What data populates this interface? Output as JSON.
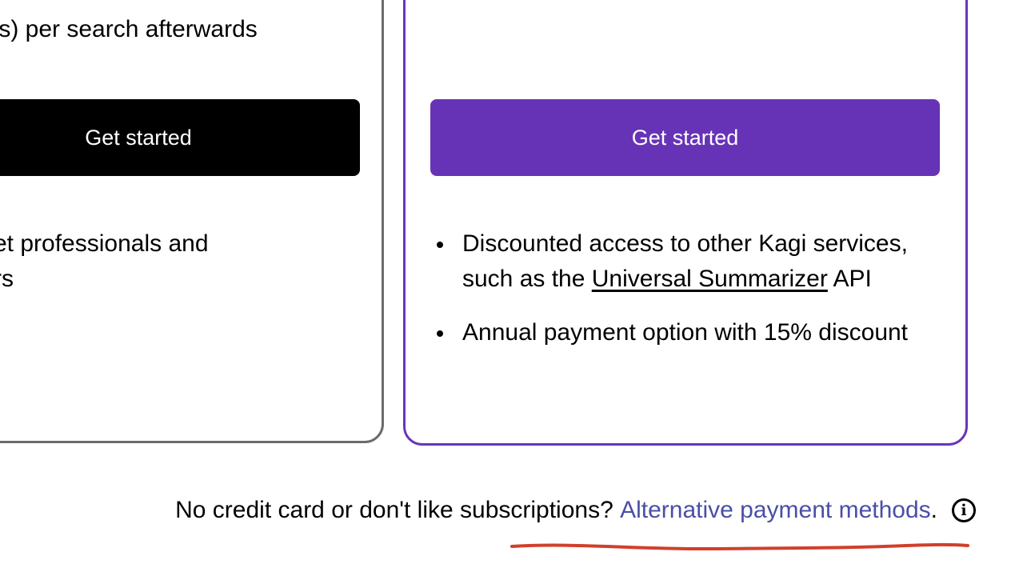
{
  "left_plan": {
    "line_pricing": "ts) per search afterwards",
    "button_label": "Get started",
    "feature_line1": "et professionals and",
    "feature_line2": "rs"
  },
  "right_plan": {
    "button_label": "Get started",
    "features": {
      "item1_text_before": "Discounted access to other Kagi services, such as the ",
      "item1_link": "Universal Summarizer",
      "item1_text_after": " API",
      "item2": "Annual payment option with 15% discount"
    }
  },
  "footer": {
    "prompt": "No credit card or don't like subscriptions? ",
    "link_label": "Alternative payment methods",
    "suffix": ".",
    "info_icon_glyph": "i"
  },
  "icons": {
    "info": "info-circle-icon"
  },
  "colors": {
    "accent_purple": "#6733b6",
    "card_border_purple": "#6a35b8",
    "card_border_gray": "#6b6b6b",
    "link_blue": "#4a4fa6",
    "annotation_red": "#d0402b"
  }
}
